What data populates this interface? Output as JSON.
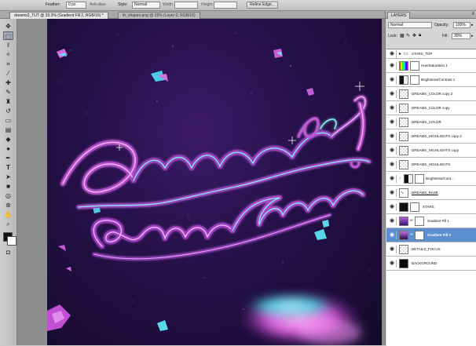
{
  "options_bar": {
    "feather_label": "Feather:",
    "feather_value": "0 px",
    "antialias_label": "Anti-alias",
    "style_label": "Style:",
    "style_value": "Normal",
    "width_label": "Width:",
    "height_label": "Height:",
    "refine_edge": "Refine Edge..."
  },
  "document_tabs": [
    {
      "label": "dreams3_TUT @ 33.3% (Gradient Fill 2, RGB/16) *",
      "active": true
    },
    {
      "label": "th_shapes.png @ 25% (Layer 0, RGB/16)",
      "active": false
    }
  ],
  "layers_panel": {
    "tab_label": "LAYERS",
    "blend_mode": "Normal",
    "opacity_label": "Opacity:",
    "opacity_value": "100%",
    "lock_label": "Lock:",
    "fill_label": "Fill:",
    "fill_value": "30%",
    "layers": [
      {
        "name": "STARS_TOP",
        "kind": "group",
        "selected": false
      },
      {
        "name": "Hue/Saturation 1",
        "kind": "adjustment",
        "selected": false
      },
      {
        "name": "Brightness/Contrast 1",
        "kind": "adjustment",
        "selected": false
      },
      {
        "name": "DREAMS_COLOR copy 2",
        "kind": "pixel",
        "selected": false
      },
      {
        "name": "DREAMS_COLOR copy",
        "kind": "pixel",
        "selected": false
      },
      {
        "name": "DREAMS_COLOR",
        "kind": "pixel",
        "selected": false
      },
      {
        "name": "DREAMS_HIGHLIGHTS copy 2",
        "kind": "pixel",
        "selected": false
      },
      {
        "name": "DREAMS_HIGHLIGHTS copy",
        "kind": "pixel",
        "selected": false
      },
      {
        "name": "DREAMS_HIGHLIGHTS",
        "kind": "pixel",
        "selected": false
      },
      {
        "name": "Brightness/Cont...",
        "kind": "adjustment",
        "selected": false
      },
      {
        "name": "DREAMS_BASE",
        "kind": "pixel",
        "selected": false
      },
      {
        "name": "STARS",
        "kind": "pixel",
        "selected": false
      },
      {
        "name": "Gradient Fill 1",
        "kind": "gradient",
        "selected": false
      },
      {
        "name": "Gradient Fill 2",
        "kind": "gradient",
        "selected": true
      },
      {
        "name": "DETAILS_FOCUS",
        "kind": "pixel",
        "selected": false
      },
      {
        "name": "BACKGROUND",
        "kind": "fill",
        "selected": false
      }
    ]
  },
  "colors": {
    "selection": "#5b8fcf",
    "canvas_dark": "#1b0d36",
    "glow_pink": "#e070e8",
    "glow_cyan": "#55e4f0"
  }
}
